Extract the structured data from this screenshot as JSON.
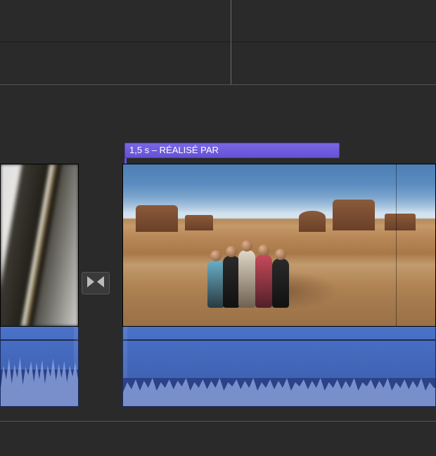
{
  "title_overlay": {
    "label": "1,5 s – RÉALISÉ PAR",
    "duration_seconds": 1.5,
    "name": "RÉALISÉ PAR",
    "color": "#6452d6"
  },
  "transition": {
    "icon": "crossfade-transition-icon"
  }
}
